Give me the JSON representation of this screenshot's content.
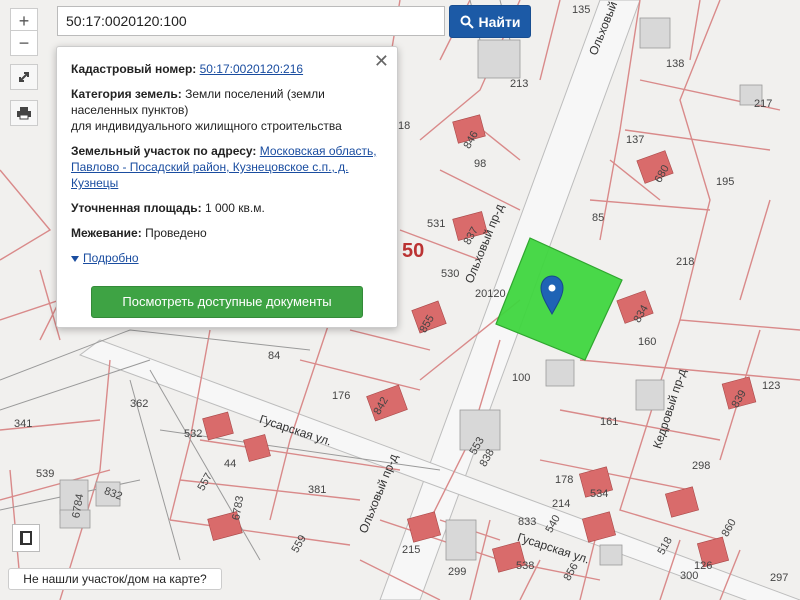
{
  "search": {
    "value": "50:17:0020120:100",
    "button_label": "Найти"
  },
  "controls": {
    "zoom_in": "+",
    "zoom_out": "−"
  },
  "popup": {
    "cadastral_label": "Кадастровый номер:",
    "cadastral_value": "50:17:0020120:216",
    "category_label": "Категория земель:",
    "category_value": "Земли поселений (земли населенных пунктов)",
    "category_use": "для индивидуального жилищного строительства",
    "address_label": "Земельный участок по адресу:",
    "address_value": "Московская область, Павлово - Посадский район, Кузнецовское с.п., д. Кузнецы",
    "area_label": "Уточненная площадь:",
    "area_value": "1 000 кв.м.",
    "survey_label": "Межевание:",
    "survey_value": "Проведено",
    "details_link": "Подробно",
    "docs_button": "Посмотреть доступные документы",
    "close": "✕"
  },
  "not_found": "Не нашли участок/дом на карте?",
  "map": {
    "labels": [
      "135",
      "138",
      "213",
      "217",
      "137",
      "18",
      "846",
      "98",
      "195",
      "680",
      "85",
      "531",
      "837",
      "218",
      "50",
      "530",
      "20120",
      "855",
      "834",
      "160",
      "84",
      "100",
      "123",
      "362",
      "176",
      "842",
      "161",
      "839",
      "341",
      "532",
      "553",
      "838",
      "44",
      "178",
      "534",
      "539",
      "557",
      "381",
      "832",
      "214",
      "6783",
      "833",
      "6784",
      "538",
      "559",
      "215",
      "299",
      "518",
      "300",
      "297",
      "298",
      "126",
      "856",
      "860",
      "540"
    ],
    "streets": [
      "Ольховый пр-д",
      "Ольховый пр-д",
      "Ольховый пр-д",
      "Гусарская ул.",
      "Гусарская ул.",
      "Кедровый пр-д"
    ]
  },
  "colors": {
    "parcel_line": "#d98a8a",
    "highlight": "#3fd63f",
    "building": "#d96b6b",
    "marker": "#1f63b5"
  }
}
